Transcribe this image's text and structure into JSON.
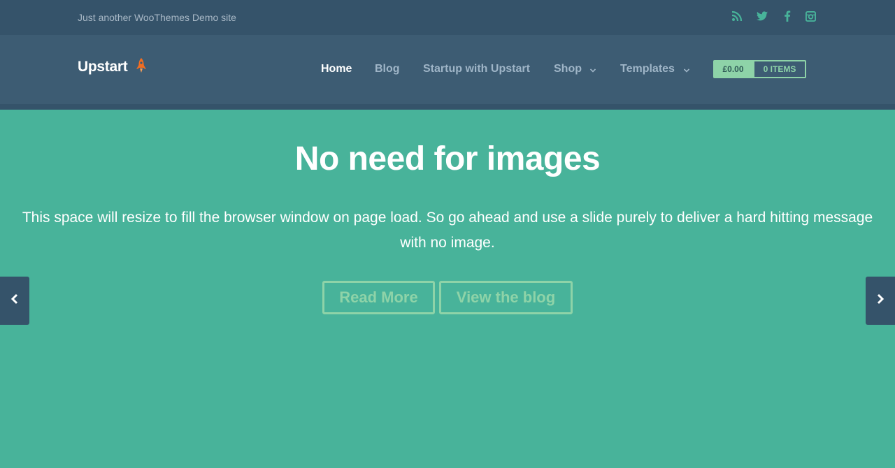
{
  "topbar": {
    "tagline": "Just another WooThemes Demo site",
    "social_icons": [
      "rss-icon",
      "twitter-icon",
      "facebook-icon",
      "instagram-icon"
    ]
  },
  "header": {
    "logo": "Upstart",
    "nav": [
      {
        "label": "Home",
        "active": true
      },
      {
        "label": "Blog"
      },
      {
        "label": "Startup with Upstart"
      },
      {
        "label": "Shop",
        "has_dropdown": true
      },
      {
        "label": "Templates",
        "has_dropdown": true
      }
    ],
    "cart": {
      "price": "£0.00",
      "items": "0 ITEMS"
    }
  },
  "hero": {
    "title": "No need for images",
    "text": "This space will resize to fill the browser window on page load. So go ahead and use a slide purely to deliver a hard hitting message with no image.",
    "buttons": {
      "read_more": "Read More",
      "view_blog": "View the blog"
    }
  },
  "colors": {
    "hero_bg": "#48b39a",
    "topbar_bg": "#35536a",
    "header_bg": "#3d5c73",
    "accent": "#8ed3a8",
    "rocket": "#f26d21"
  }
}
